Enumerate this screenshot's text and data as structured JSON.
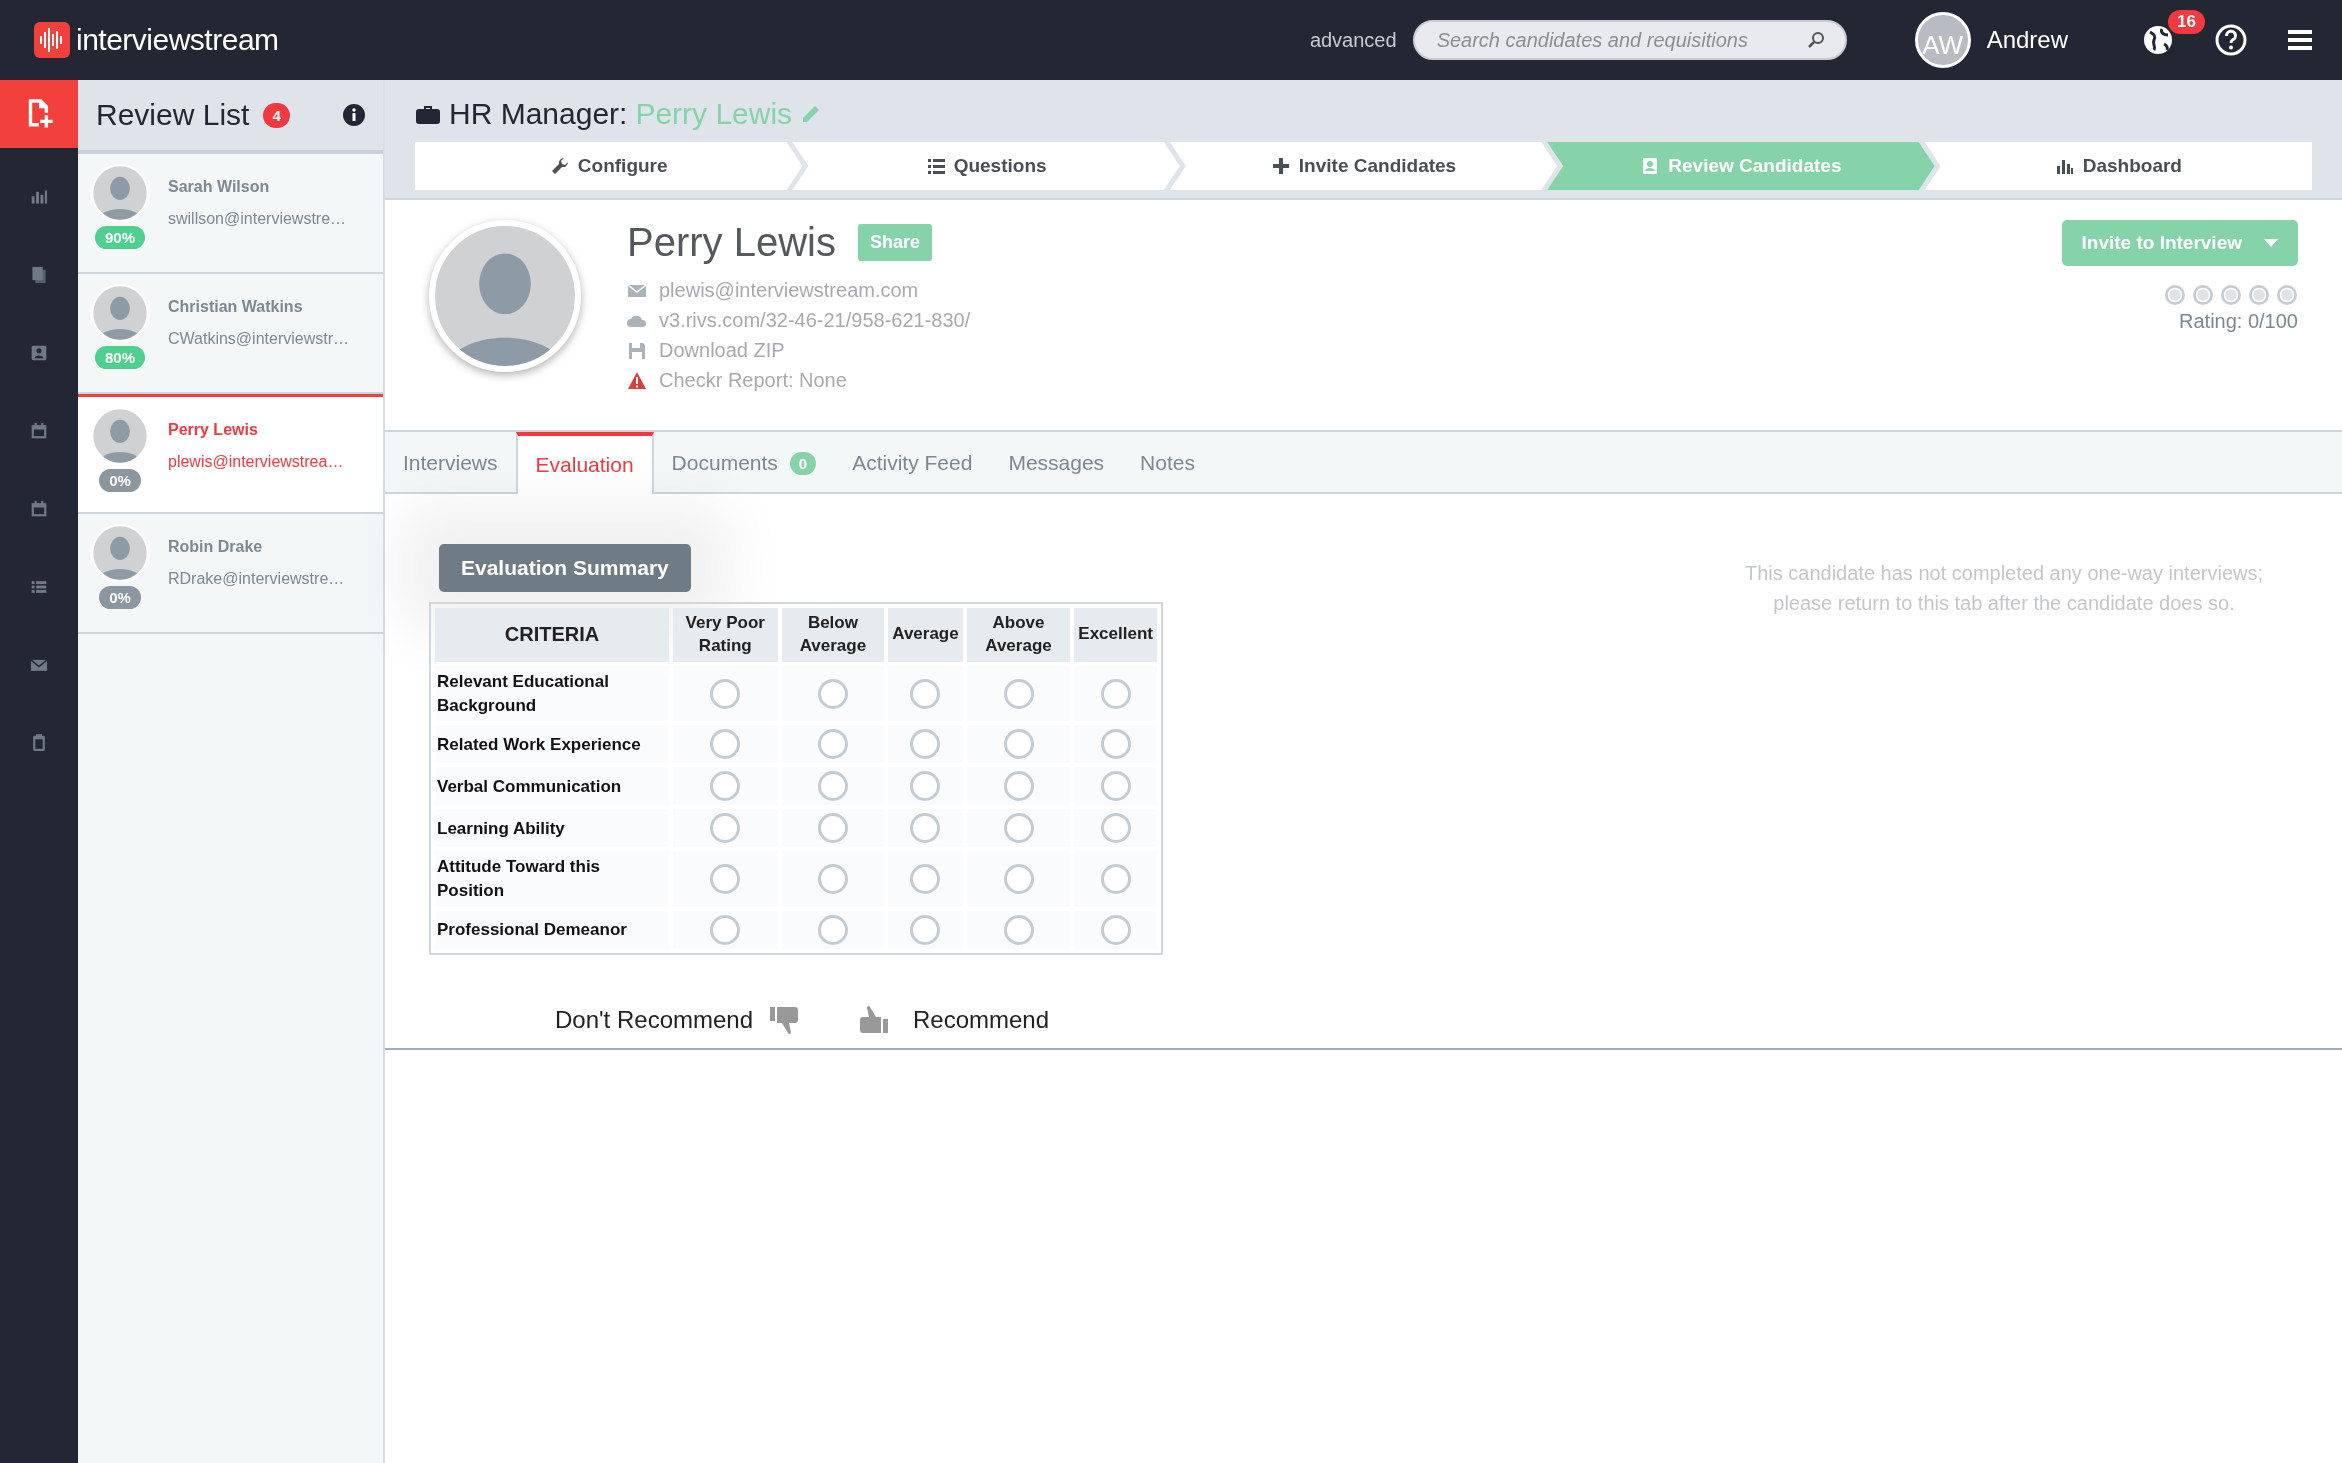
{
  "topbar": {
    "logo": "interviewstream",
    "advanced_link": "advanced",
    "search": {
      "placeholder": "Search candidates and requisitions"
    },
    "user": {
      "initials": "AW",
      "name": "Andrew"
    },
    "notifications_count": "16"
  },
  "nav_rail": [
    {
      "kind": "new-file",
      "selected": true
    },
    {
      "kind": "stats",
      "selected": false
    },
    {
      "kind": "documents",
      "selected": false
    },
    {
      "kind": "contact",
      "selected": false
    },
    {
      "kind": "calendar",
      "selected": false
    },
    {
      "kind": "calendar",
      "selected": false
    },
    {
      "kind": "list",
      "selected": false
    },
    {
      "kind": "mail",
      "selected": false
    },
    {
      "kind": "clipboard",
      "selected": false
    }
  ],
  "review_list": {
    "title": "Review List",
    "count": "4",
    "candidates": [
      {
        "name": "Sarah Wilson",
        "email": "swillson@interviewstre…",
        "score": "90%",
        "color": "#4fd08e",
        "selected": false
      },
      {
        "name": "Christian Watkins",
        "email": "CWatkins@interviewstr…",
        "score": "80%",
        "color": "#4fd08e",
        "selected": false
      },
      {
        "name": "Perry Lewis",
        "email": "plewis@interviewstrea…",
        "score": "0%",
        "color": "#8a96a0",
        "selected": true
      },
      {
        "name": "Robin Drake",
        "email": "RDrake@interviewstre…",
        "score": "0%",
        "color": "#8a96a0",
        "selected": false
      }
    ]
  },
  "header": {
    "label": "HR Manager:",
    "position": "Perry Lewis"
  },
  "steps": [
    {
      "label": "Configure",
      "kind": "wrench",
      "selected": false
    },
    {
      "label": "Questions",
      "kind": "list",
      "selected": false
    },
    {
      "label": "Invite Candidates",
      "kind": "plus",
      "selected": false
    },
    {
      "label": "Review Candidates",
      "kind": "contact",
      "selected": true
    },
    {
      "label": "Dashboard",
      "kind": "chart",
      "selected": false
    }
  ],
  "profile": {
    "name": "Perry Lewis",
    "share": "Share",
    "details": [
      {
        "kind": "email",
        "text": "plewis@interviewstream.com"
      },
      {
        "kind": "cloud",
        "text": "v3.rivs.com/32-46-21/958-621-830/"
      },
      {
        "kind": "save",
        "text": "Download ZIP"
      },
      {
        "kind": "warning",
        "text": "Checkr Report: None"
      }
    ],
    "invite_button": "Invite to Interview",
    "rating": "Rating: 0/100"
  },
  "tabs": [
    {
      "label": "Interviews",
      "selected": false
    },
    {
      "label": "Evaluation",
      "selected": true
    },
    {
      "label": "Documents",
      "badge": "0",
      "selected": false
    },
    {
      "label": "Activity Feed",
      "selected": false
    },
    {
      "label": "Messages",
      "selected": false
    },
    {
      "label": "Notes",
      "selected": false
    }
  ],
  "evaluation": {
    "summary_button": "Evaluation Summary",
    "columns": [
      "CRITERIA",
      "Very Poor Rating",
      "Below Average",
      "Average",
      "Above Average",
      "Excellent"
    ],
    "rows": [
      {
        "criterion": "Relevant Educational Background",
        "choices": [
          {
            "selected": false
          },
          {
            "selected": false
          },
          {
            "selected": false
          },
          {
            "selected": false
          },
          {
            "selected": false
          }
        ]
      },
      {
        "criterion": "Related Work Experience",
        "choices": [
          {
            "selected": false
          },
          {
            "selected": false
          },
          {
            "selected": false
          },
          {
            "selected": false
          },
          {
            "selected": false
          }
        ]
      },
      {
        "criterion": "Verbal Communication",
        "choices": [
          {
            "selected": false
          },
          {
            "selected": false
          },
          {
            "selected": false
          },
          {
            "selected": false
          },
          {
            "selected": false
          }
        ]
      },
      {
        "criterion": "Learning Ability",
        "choices": [
          {
            "selected": false
          },
          {
            "selected": false
          },
          {
            "selected": false
          },
          {
            "selected": false
          },
          {
            "selected": false
          }
        ]
      },
      {
        "criterion": "Attitude Toward this Position",
        "choices": [
          {
            "selected": false
          },
          {
            "selected": false
          },
          {
            "selected": false
          },
          {
            "selected": false
          },
          {
            "selected": false
          }
        ]
      },
      {
        "criterion": "Professional Demeanor",
        "choices": [
          {
            "selected": false
          },
          {
            "selected": false
          },
          {
            "selected": false
          },
          {
            "selected": false
          },
          {
            "selected": false
          }
        ]
      }
    ],
    "dont_recommend": "Don't Recommend",
    "recommend": "Recommend"
  },
  "notice": "This candidate has not completed any one-way interviews; please return to this tab after the candidate does so."
}
